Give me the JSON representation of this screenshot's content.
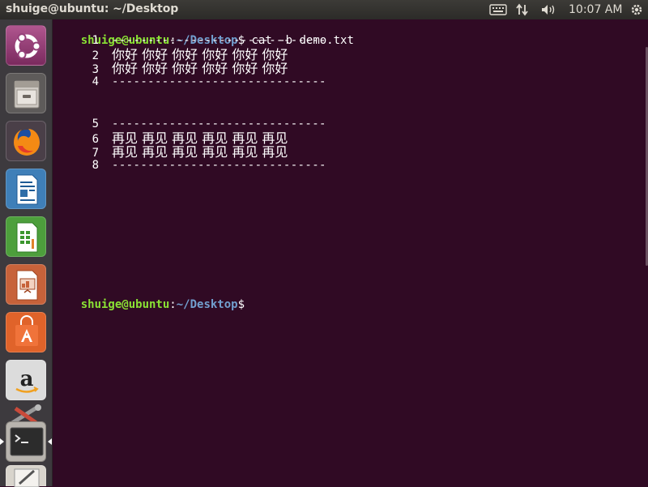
{
  "window": {
    "title": "shuige@ubuntu: ~/Desktop"
  },
  "panel": {
    "clock": "10:07 AM",
    "indicators": [
      "keyboard-icon",
      "network-arrows-icon",
      "volume-icon",
      "power-gear-icon"
    ]
  },
  "launcher": {
    "items": [
      {
        "name": "ubuntu-dash",
        "icon": "ubuntu-logo-icon"
      },
      {
        "name": "files",
        "icon": "file-cabinet-icon"
      },
      {
        "name": "firefox",
        "icon": "firefox-icon"
      },
      {
        "name": "libreoffice-writer",
        "icon": "writer-document-icon"
      },
      {
        "name": "libreoffice-calc",
        "icon": "calc-spreadsheet-icon"
      },
      {
        "name": "libreoffice-impress",
        "icon": "impress-presentation-icon"
      },
      {
        "name": "ubuntu-software",
        "icon": "shopping-bag-icon"
      },
      {
        "name": "amazon",
        "icon": "amazon-icon"
      },
      {
        "name": "system-settings",
        "icon": "settings-tools-icon"
      },
      {
        "name": "terminal",
        "icon": "terminal-icon"
      },
      {
        "name": "text-editor",
        "icon": "text-editor-icon"
      }
    ],
    "active_color": "#e95420"
  },
  "terminal": {
    "prompt_user": "shuige@ubuntu",
    "prompt_sep": ":",
    "prompt_path": "~/Desktop",
    "prompt_end": "$",
    "command": " cat -b demo.txt",
    "lines": [
      {
        "num": "1",
        "text": "------------------------------"
      },
      {
        "num": "2",
        "text": "你好 你好 你好 你好 你好 你好"
      },
      {
        "num": "3",
        "text": "你好 你好 你好 你好 你好 你好"
      },
      {
        "num": "4",
        "text": "------------------------------"
      },
      {
        "num": "5",
        "text": "------------------------------"
      },
      {
        "num": "6",
        "text": "再见 再见 再见 再见 再见 再见"
      },
      {
        "num": "7",
        "text": "再见 再见 再见 再见 再见 再见"
      },
      {
        "num": "8",
        "text": "------------------------------"
      }
    ],
    "colors": {
      "background": "#300a24",
      "user": "#8ae234",
      "path": "#729fcf",
      "text": "#ffffff"
    }
  }
}
